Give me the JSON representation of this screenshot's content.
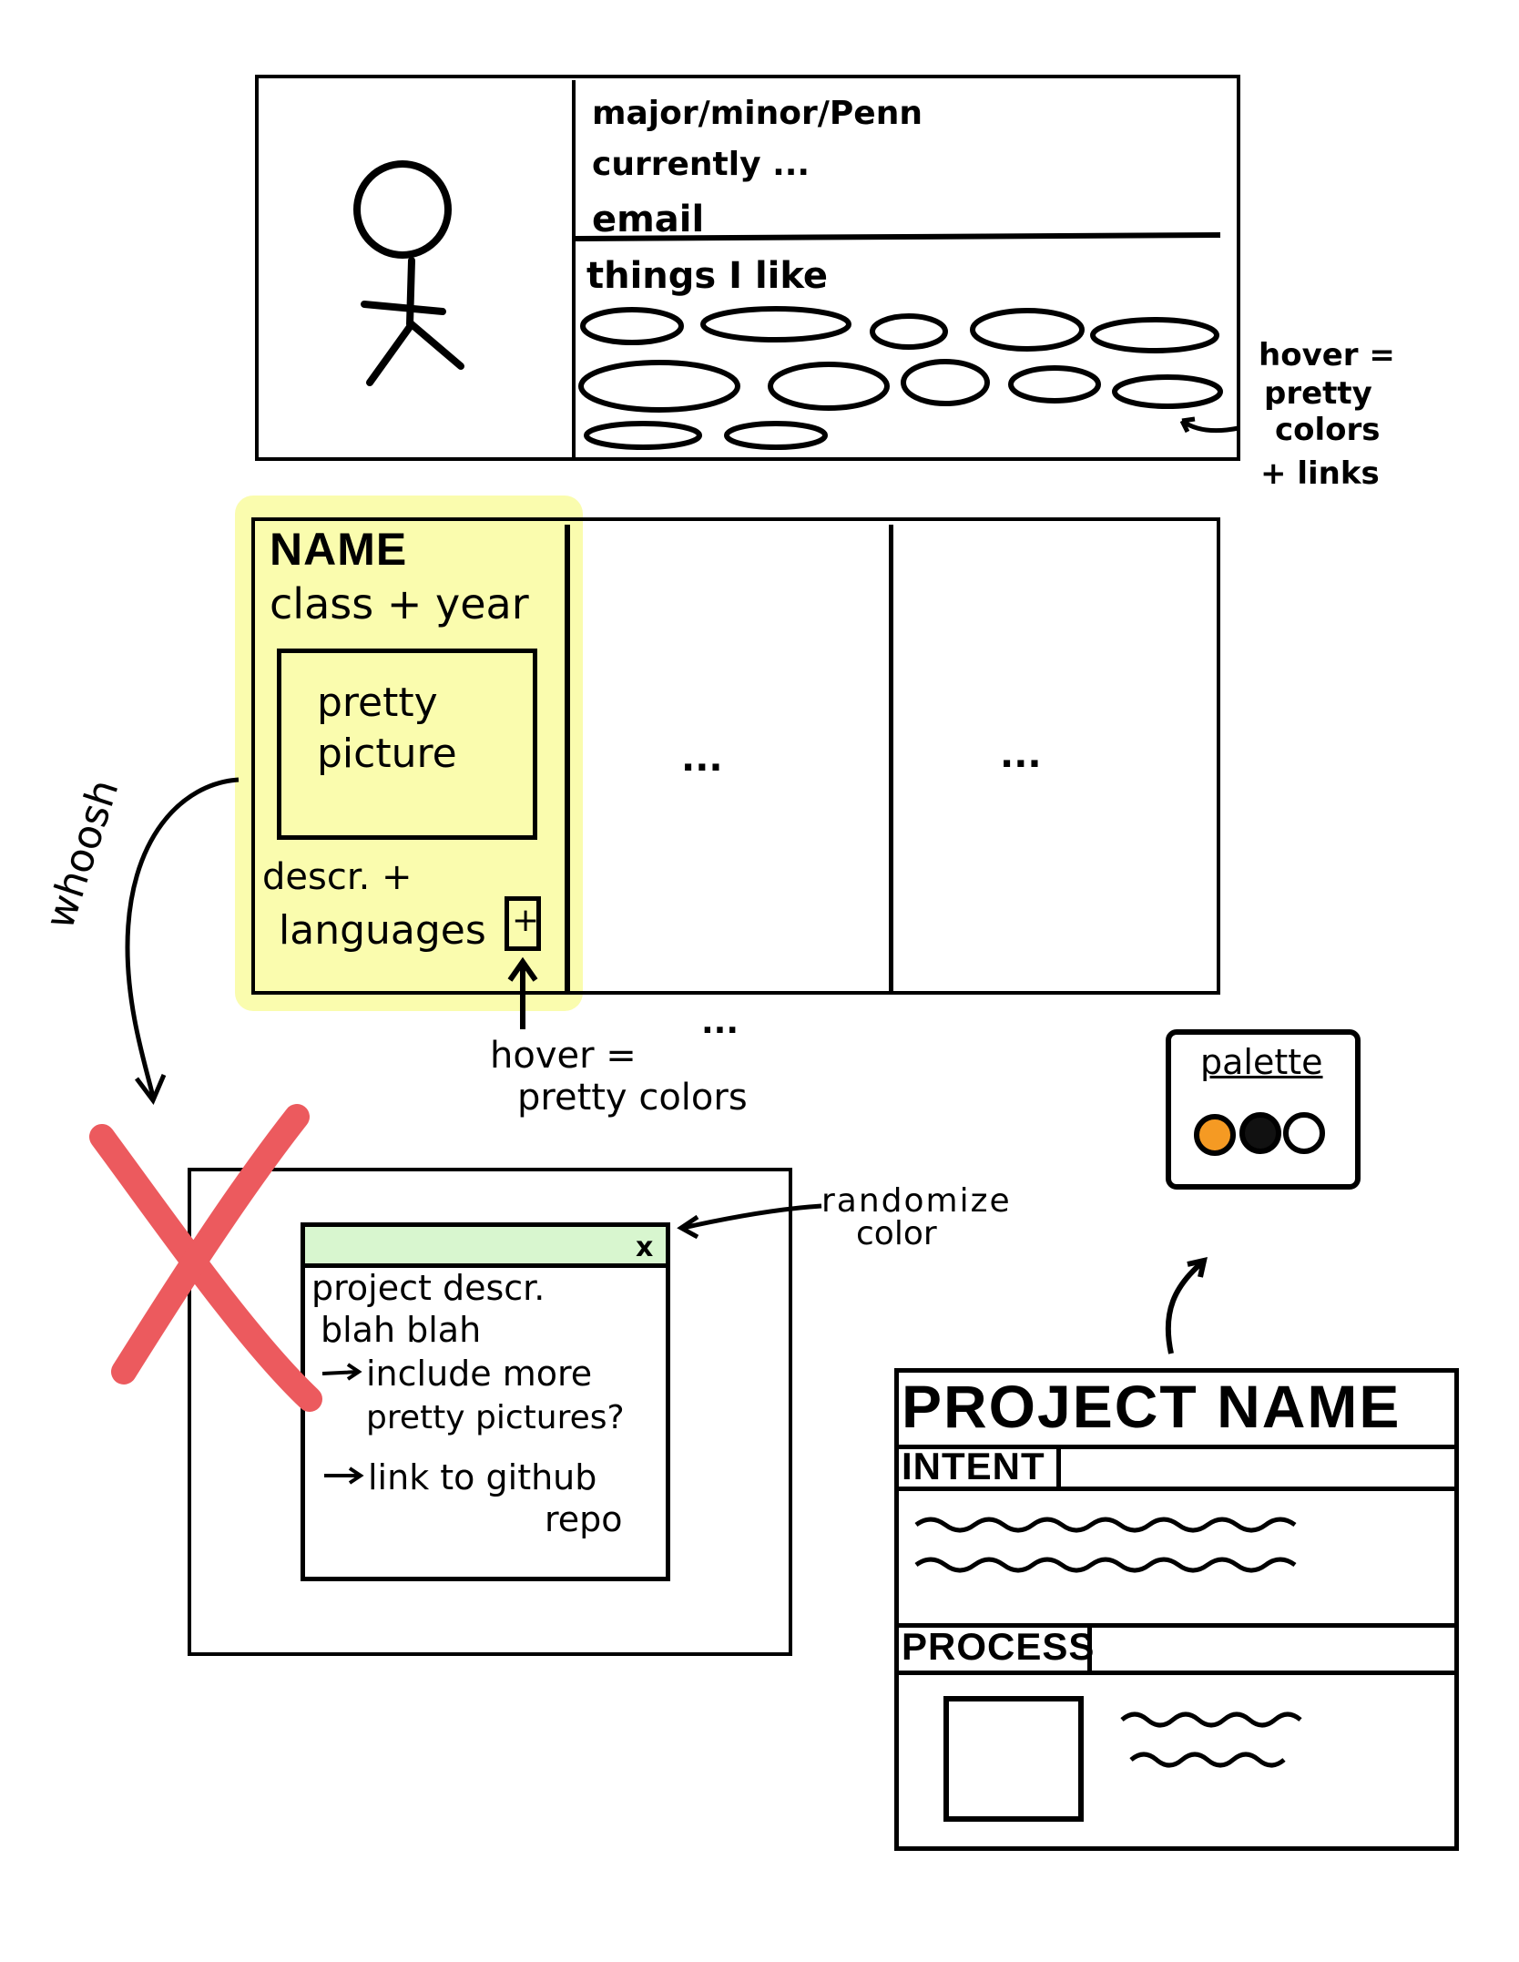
{
  "profile": {
    "line1": "major/minor/Penn",
    "line2": "currently ...",
    "email": "email",
    "things_heading": "things I like"
  },
  "hover_note_tags": {
    "line1": "hover =",
    "line2": "pretty",
    "line3": "colors",
    "line4": "+ links"
  },
  "project_card": {
    "name": "NAME",
    "class_year": "class + year",
    "picture": "pretty picture",
    "descr": "descr. +",
    "languages": "languages",
    "plus": "+",
    "highlight_color": "#fafcae"
  },
  "cards": {
    "ellipsis_2": "...",
    "ellipsis_3": "...",
    "ellipsis_below": "..."
  },
  "hover_note_card": {
    "line1": "hover =",
    "line2": "pretty colors"
  },
  "whoosh": "whoosh",
  "popup": {
    "close": "x",
    "desc1": "project descr.",
    "desc2": "blah blah",
    "bullet1a": "include more",
    "bullet1b": "pretty pictures?",
    "bullet2a": "link to github",
    "bullet2b": "repo",
    "titlebar_color": "#d8f6cf",
    "cross_color": "#ec5a5e"
  },
  "randomize_note": {
    "line1": "randomize",
    "line2": "color"
  },
  "palette": {
    "label": "palette",
    "swatches": [
      "#f59a23",
      "#111111",
      "#ffffff"
    ]
  },
  "project_page": {
    "title": "PROJECT NAME",
    "intent": "INTENT",
    "process": "PROCESS"
  }
}
